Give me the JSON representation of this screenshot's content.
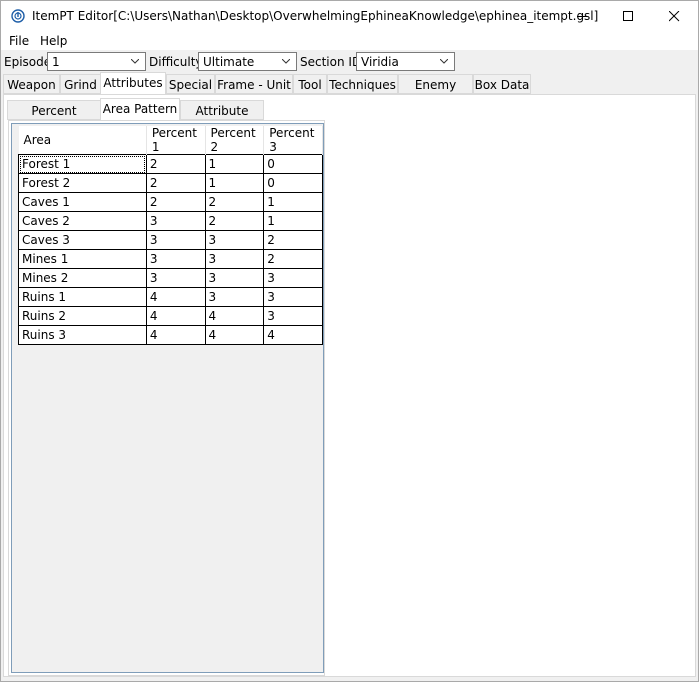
{
  "window": {
    "title": "ItemPT Editor[C:\\Users\\Nathan\\Desktop\\OverwhelmingEphineaKnowledge\\ephinea_itempt.gsl]"
  },
  "menu": [
    "File",
    "Help"
  ],
  "filters": {
    "episode_label": "Episode",
    "episode_value": "1",
    "difficulty_label": "Difficulty",
    "difficulty_value": "Ultimate",
    "section_label": "Section ID",
    "section_value": "Viridia"
  },
  "tabs": [
    "Weapon",
    "Grind",
    "Attributes",
    "Special",
    "Frame - Unit",
    "Tool",
    "Techniques",
    "Enemy Data",
    "Box Data"
  ],
  "active_tab": "Attributes",
  "subtabs": [
    "Percent Pattern",
    "Area Pattern",
    "Attribute Rate"
  ],
  "active_subtab": "Area Pattern",
  "table": {
    "columns": [
      "Area",
      "Percent 1",
      "Percent 2",
      "Percent 3"
    ],
    "rows": [
      [
        "Forest 1",
        "2",
        "1",
        "0"
      ],
      [
        "Forest 2",
        "2",
        "1",
        "0"
      ],
      [
        "Caves 1",
        "2",
        "2",
        "1"
      ],
      [
        "Caves 2",
        "3",
        "2",
        "1"
      ],
      [
        "Caves 3",
        "3",
        "3",
        "2"
      ],
      [
        "Mines 1",
        "3",
        "3",
        "2"
      ],
      [
        "Mines 2",
        "3",
        "3",
        "3"
      ],
      [
        "Ruins 1",
        "4",
        "3",
        "3"
      ],
      [
        "Ruins 2",
        "4",
        "4",
        "3"
      ],
      [
        "Ruins 3",
        "4",
        "4",
        "4"
      ]
    ]
  }
}
